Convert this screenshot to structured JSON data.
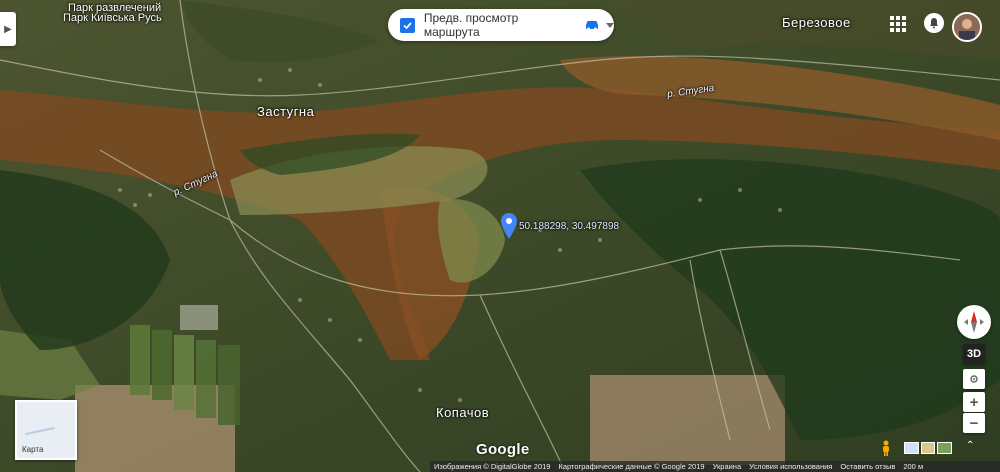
{
  "map": {
    "place_labels": {
      "zastugna": "Застугна",
      "berezovoe": "Березовое",
      "kopachov": "Копачов",
      "park_ru": "Парк развлечений",
      "park_ua": "Парк Київська Русь"
    },
    "river_labels": {
      "river_top": "р. Стугна",
      "river_left": "р. Стугна"
    },
    "marker": {
      "coordinates": "50.188298, 30.497898",
      "color": "#4285f4"
    }
  },
  "route_preview": {
    "label": "Предв. просмотр маршрута",
    "checked": true,
    "mode_icon": "car-icon"
  },
  "header": {
    "apps_icon": "apps-grid-icon",
    "notifications_icon": "bell-icon",
    "avatar_icon": "user-avatar"
  },
  "controls": {
    "btn_3d": "3D",
    "zoom_in": "+",
    "zoom_out": "−",
    "compass_icon": "compass-icon",
    "locate_icon": "my-location-icon"
  },
  "minimap": {
    "label": "Карта"
  },
  "watermark": "Google",
  "footer": {
    "imagery": "Изображения © DigitalGlobe 2019",
    "mapdata": "Картографические данные © Google 2019",
    "country": "Украина",
    "terms": "Условия использования",
    "feedback": "Оставить отзыв",
    "scale": "200 м"
  }
}
